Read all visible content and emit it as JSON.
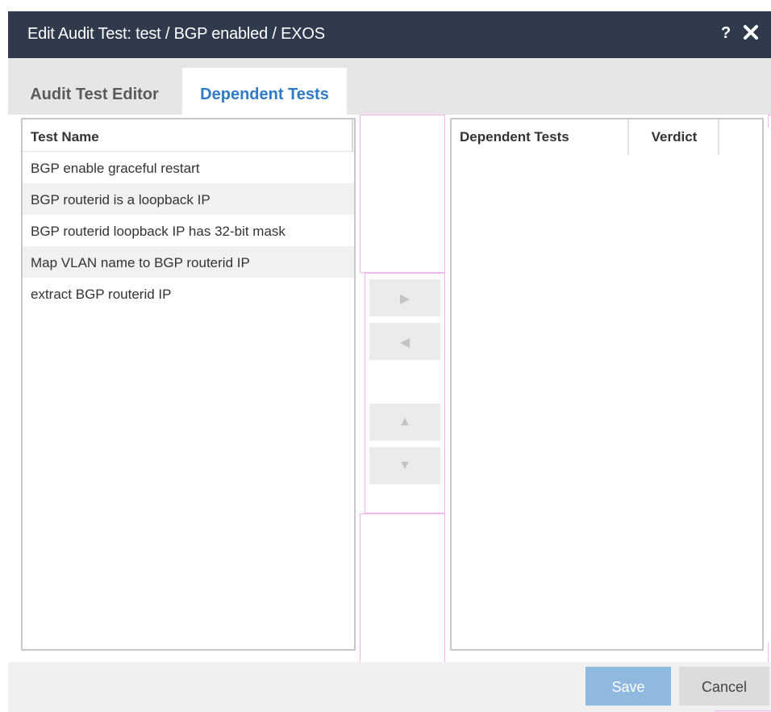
{
  "dialog": {
    "title": "Edit Audit Test: test / BGP enabled / EXOS",
    "help_label": "?"
  },
  "tabs": [
    {
      "label": "Audit Test Editor",
      "active": false
    },
    {
      "label": "Dependent Tests",
      "active": true
    }
  ],
  "available_tests": {
    "column_header": "Test Name",
    "items": [
      "BGP enable graceful restart",
      "BGP routerid is a loopback IP",
      "BGP routerid loopback IP has 32-bit mask",
      "Map VLAN name to BGP routerid IP",
      "extract BGP routerid IP"
    ]
  },
  "transfer_buttons": {
    "add_icon": "▶",
    "remove_icon": "◀",
    "up_icon": "▲",
    "down_icon": "▼"
  },
  "dependent_tests": {
    "columns": [
      "Dependent Tests",
      "Verdict"
    ],
    "rows": []
  },
  "footer": {
    "save_label": "Save",
    "cancel_label": "Cancel"
  },
  "colors": {
    "titlebar": "#2f3b4c",
    "active_tab": "#2f7bc6",
    "save_button": "#90b9e0"
  }
}
